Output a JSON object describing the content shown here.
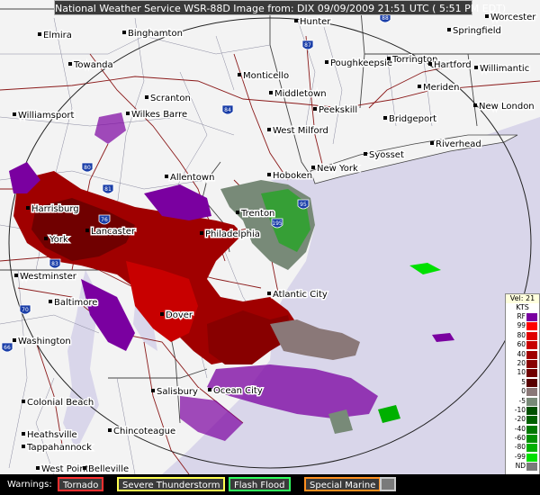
{
  "header": {
    "title": "National Weather Service WSR-88D Image from: DIX 09/09/2009 21:51 UTC ( 5:51 PM EDT)"
  },
  "cities": [
    {
      "name": "Worcester"
    },
    {
      "name": "Elmira"
    },
    {
      "name": "Binghamton"
    },
    {
      "name": "Hunter"
    },
    {
      "name": "Springfield"
    },
    {
      "name": "Towanda"
    },
    {
      "name": "Monticello"
    },
    {
      "name": "Poughkeepsie"
    },
    {
      "name": "Torrington"
    },
    {
      "name": "Hartford"
    },
    {
      "name": "Willimantic"
    },
    {
      "name": "Middletown"
    },
    {
      "name": "Meriden"
    },
    {
      "name": "Scranton"
    },
    {
      "name": "Wilkes Barre"
    },
    {
      "name": "Peekskill"
    },
    {
      "name": "New London"
    },
    {
      "name": "Williamsport"
    },
    {
      "name": "Bridgeport"
    },
    {
      "name": "West Milford"
    },
    {
      "name": "Riverhead"
    },
    {
      "name": "Syosset"
    },
    {
      "name": "Hoboken"
    },
    {
      "name": "New York"
    },
    {
      "name": "Allentown"
    },
    {
      "name": "Harrisburg"
    },
    {
      "name": "Trenton"
    },
    {
      "name": "Lancaster"
    },
    {
      "name": "Philadelphia"
    },
    {
      "name": "York"
    },
    {
      "name": "Westminster"
    },
    {
      "name": "Atlantic City"
    },
    {
      "name": "Baltimore"
    },
    {
      "name": "Dover"
    },
    {
      "name": "Washington"
    },
    {
      "name": "Ocean City"
    },
    {
      "name": "Salisbury"
    },
    {
      "name": "Colonial Beach"
    },
    {
      "name": "Chincoteague"
    },
    {
      "name": "Heathsville"
    },
    {
      "name": "Tappahannock"
    },
    {
      "name": "West Point"
    },
    {
      "name": "Belleville"
    }
  ],
  "highways": [
    "88",
    "87",
    "84",
    "80",
    "81",
    "76",
    "95",
    "83",
    "70",
    "66",
    "195"
  ],
  "legend": {
    "title": "Vel: 21",
    "units": "KTS",
    "rows": [
      {
        "label": "RF",
        "color": "#7a00a0"
      },
      {
        "label": "99",
        "color": "#ff0000"
      },
      {
        "label": "80",
        "color": "#e00000"
      },
      {
        "label": "60",
        "color": "#c80000"
      },
      {
        "label": "40",
        "color": "#a00000"
      },
      {
        "label": "20",
        "color": "#880000"
      },
      {
        "label": "10",
        "color": "#700000"
      },
      {
        "label": "5",
        "color": "#580000"
      },
      {
        "label": "0",
        "color": "#8a7878"
      },
      {
        "label": "-5",
        "color": "#788a78"
      },
      {
        "label": "-10",
        "color": "#005000"
      },
      {
        "label": "-20",
        "color": "#006000"
      },
      {
        "label": "-40",
        "color": "#007800"
      },
      {
        "label": "-60",
        "color": "#009000"
      },
      {
        "label": "-80",
        "color": "#00b000"
      },
      {
        "label": "-99",
        "color": "#00e000"
      },
      {
        "label": "ND",
        "color": "#7a7a7a"
      }
    ]
  },
  "warnings": {
    "label": "Warnings:",
    "items": [
      {
        "label": "Tornado",
        "color": "#ff3030"
      },
      {
        "label": "Severe Thunderstorm",
        "color": "#ffff50"
      },
      {
        "label": "Flash Flood",
        "color": "#30ff60"
      },
      {
        "label": "Special Marine",
        "color": "#ff9020"
      }
    ]
  }
}
